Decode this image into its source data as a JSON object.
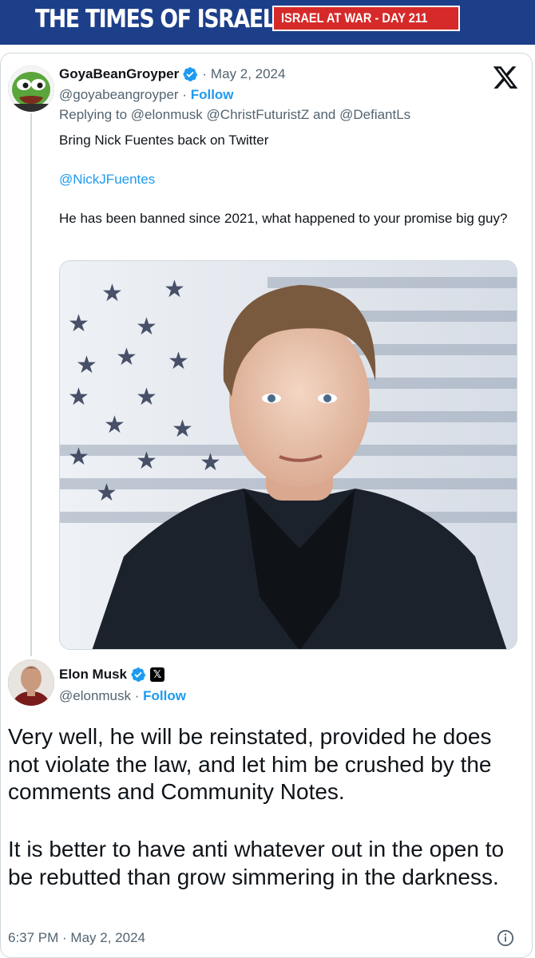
{
  "masthead": {
    "title": "THE TIMES OF ISRAEL",
    "badge": "ISRAEL AT WAR - DAY 211"
  },
  "colors": {
    "brand": "#1d3f8a",
    "badge": "#d62a2a",
    "link": "#1d9bf0",
    "muted": "#536471"
  },
  "original_tweet": {
    "author_name": "GoyaBeanGroyper",
    "date_sep": "·",
    "date": "May 2, 2024",
    "handle": "@goyabeangroyper",
    "follow_sep": " · ",
    "follow_label": "Follow",
    "replying_prefix": "Replying to",
    "replying_to_1": "@elonmusk",
    "replying_to_2": "@ChristFuturistZ",
    "replying_and": "and",
    "replying_to_3": "@DefiantLs",
    "text_line1": "Bring Nick Fuentes back on Twitter",
    "text_mention": "@NickJFuentes",
    "text_line3": "He has been banned since 2021, what happened to your promise big guy?",
    "avatar_icon": "pepe-avatar",
    "verified_icon": "verified-badge-icon"
  },
  "reply_tweet": {
    "author_name": "Elon Musk",
    "handle": "@elonmusk",
    "follow_sep": " · ",
    "follow_label": "Follow",
    "affiliate_badge": "𝕏",
    "text_para1": "Very well, he will be reinstated, provided he does not violate the law, and let him be crushed by the comments and Community Notes.",
    "text_para2": "It is better to have anti whatever out in the open to be rebutted than grow simmering in the darkness.",
    "timestamp": "6:37 PM · May 2, 2024"
  },
  "platform_logo": "x-logo-icon",
  "info_icon": "info-icon"
}
